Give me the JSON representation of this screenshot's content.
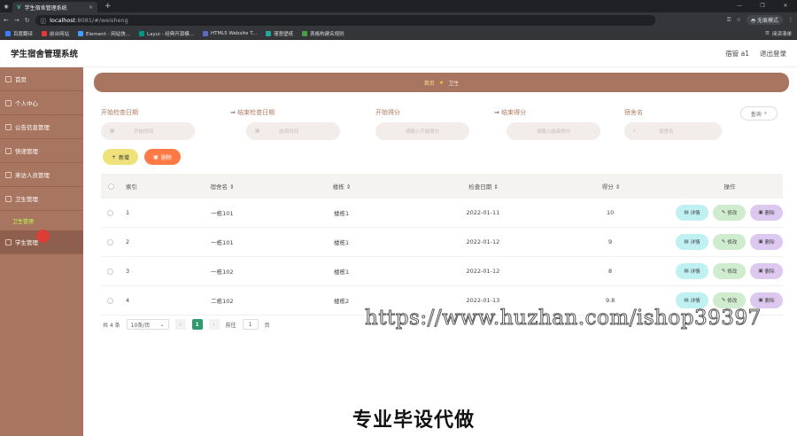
{
  "browser": {
    "tab_title": "学生宿舍管理系统",
    "tab_close": "×",
    "new_tab": "+",
    "window_controls": [
      "—",
      "❐",
      "✕"
    ],
    "url_host": "localhost",
    "url_rest": ":8081/#/weisheng",
    "profile_label": "无痕模式",
    "bookmarks": [
      {
        "label": "百度翻译",
        "color": "#3d7eff"
      },
      {
        "label": "前台网站",
        "color": "#e53935"
      },
      {
        "label": "Element - 网站快...",
        "color": "#409eff"
      },
      {
        "label": "Layui - 经典开源模...",
        "color": "#009688"
      },
      {
        "label": "HTML5 Website T...",
        "color": "#5c6bc0"
      },
      {
        "label": "瑾意壁纸",
        "color": "#26a69a"
      },
      {
        "label": "表格构建名规则",
        "color": "#43a047"
      }
    ],
    "reading_list": "阅读清单"
  },
  "header": {
    "title": "学生宿舍管理系统",
    "user": "宿管 a1",
    "logout": "退出登录"
  },
  "sidebar": {
    "items": [
      {
        "label": "首页"
      },
      {
        "label": "个人中心"
      },
      {
        "label": "公告信息管理"
      },
      {
        "label": "快递管理"
      },
      {
        "label": "来访人员管理"
      },
      {
        "label": "卫生管理"
      }
    ],
    "sub_item": "卫生管理",
    "active_item": "学生管理"
  },
  "breadcrumb": {
    "home": "首页",
    "current": "卫生"
  },
  "filters": {
    "start_date": {
      "label": "开始检查日期",
      "placeholder": "开始时间"
    },
    "end_date": {
      "label": "结束检查日期",
      "placeholder": "结束时间"
    },
    "start_score": {
      "label": "开始得分",
      "placeholder": "请输入开始得分"
    },
    "end_score": {
      "label": "结束得分",
      "placeholder": "请输入结束得分"
    },
    "dorm": {
      "label": "宿舍名",
      "placeholder": "宿舍名"
    },
    "search": "查询"
  },
  "actions": {
    "add": "新增",
    "delete": "删除"
  },
  "table": {
    "headers": {
      "index": "索引",
      "name": "宿舍名",
      "building": "楼栋",
      "date": "检查日期",
      "score": "得分",
      "op": "操作"
    },
    "op_labels": {
      "detail": "详情",
      "edit": "修改",
      "remove": "删除"
    },
    "rows": [
      {
        "index": "1",
        "name": "一栋101",
        "building": "楼栋1",
        "date": "2022-01-11",
        "score": "10"
      },
      {
        "index": "2",
        "name": "一栋101",
        "building": "楼栋1",
        "date": "2022-01-12",
        "score": "9"
      },
      {
        "index": "3",
        "name": "一栋102",
        "building": "楼栋1",
        "date": "2022-01-12",
        "score": "8"
      },
      {
        "index": "4",
        "name": "二栋102",
        "building": "楼栋2",
        "date": "2022-01-13",
        "score": "9.8"
      }
    ]
  },
  "pagination": {
    "total": "共 4 条",
    "page_size": "10条/页",
    "current": "1",
    "goto": "前往",
    "goto_value": "1",
    "page_unit": "页"
  },
  "overlay": {
    "watermark": "https://www.huzhan.com/ishop39397",
    "caption": "专业毕设代做"
  }
}
